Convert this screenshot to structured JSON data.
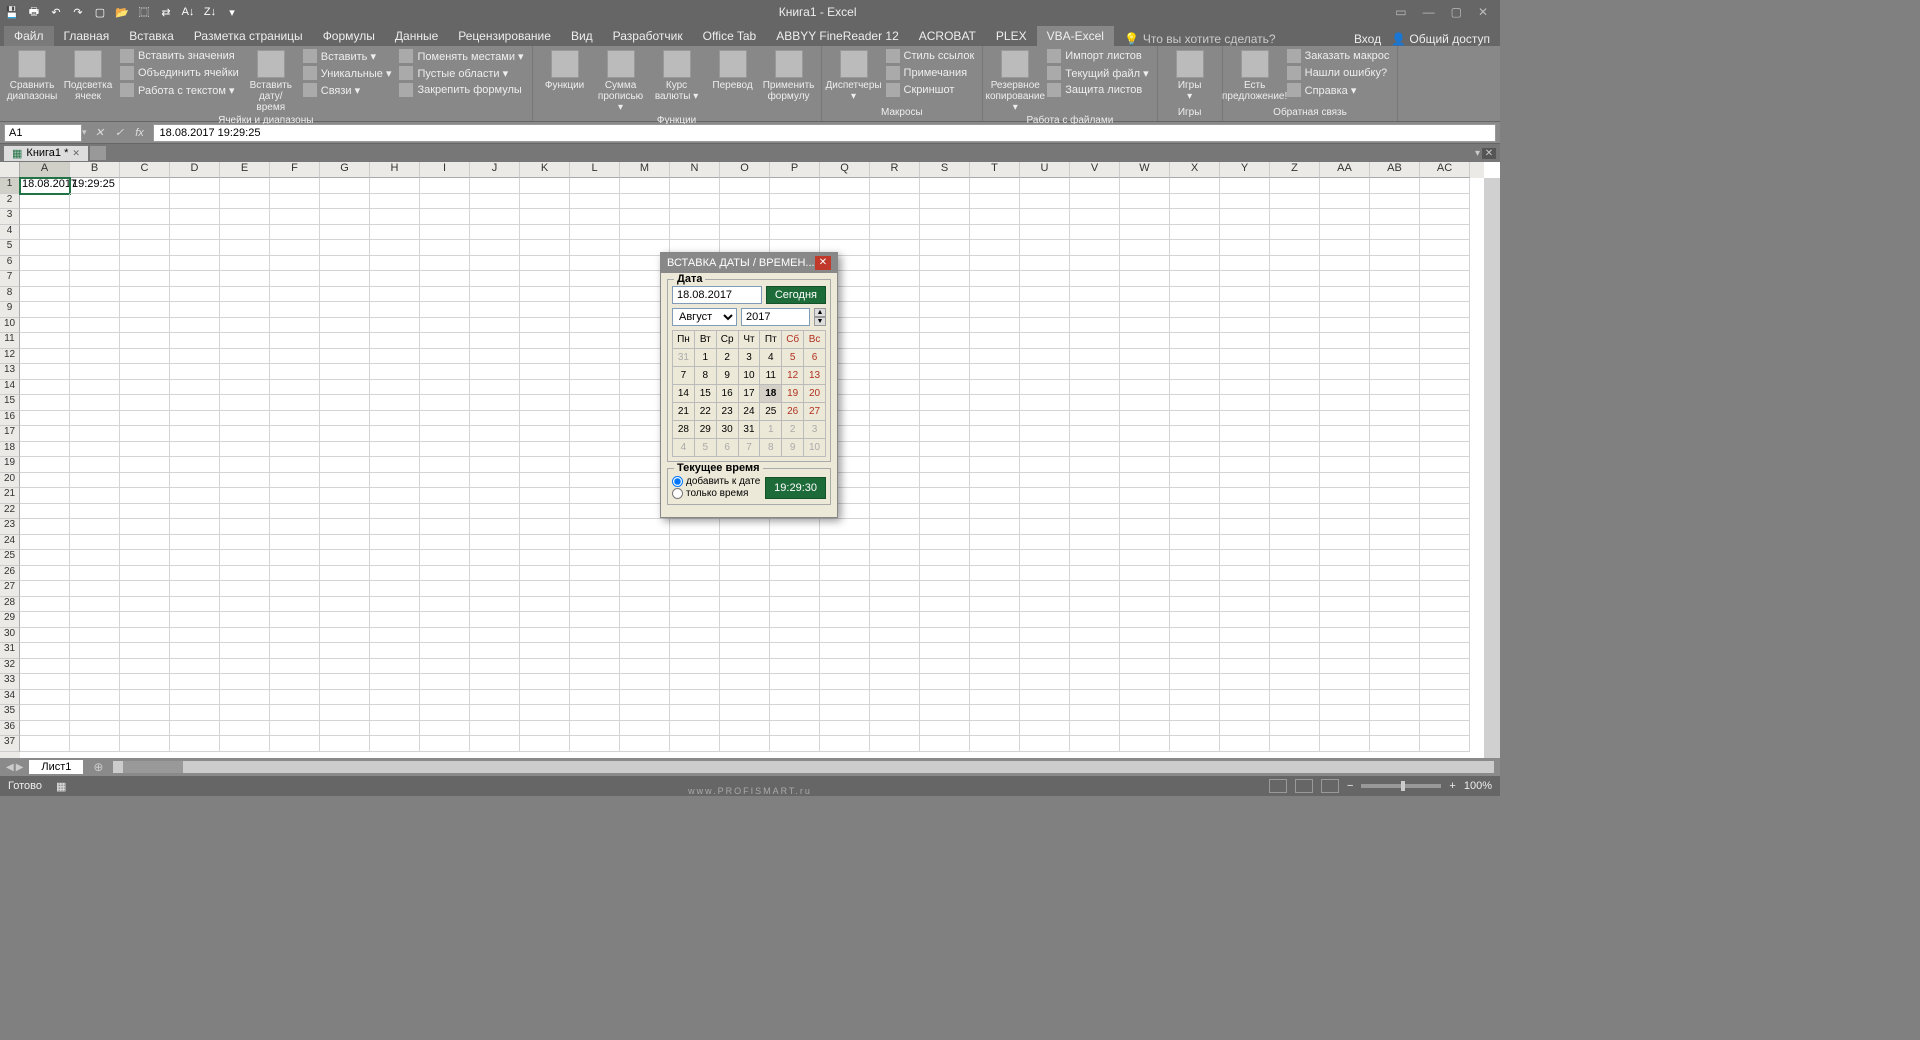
{
  "titlebar": {
    "title": "Книга1 - Excel"
  },
  "tabs": {
    "file": "Файл",
    "items": [
      "Главная",
      "Вставка",
      "Разметка страницы",
      "Формулы",
      "Данные",
      "Рецензирование",
      "Вид",
      "Разработчик",
      "Office Tab",
      "ABBYY FineReader 12",
      "ACROBAT",
      "PLEX",
      "VBA-Excel"
    ],
    "active_index": 12,
    "tellme": "Что вы хотите сделать?",
    "login": "Вход",
    "share": "Общий доступ"
  },
  "ribbon": {
    "g1": {
      "label": "Ячейки и диапазоны",
      "big": [
        "Сравнить\nдиапазоны",
        "Подсветка\nячеек"
      ],
      "small1": [
        "Вставить значения",
        "Объединить ячейки",
        "Работа с текстом ▾"
      ],
      "big2": "Вставить\nдату/время",
      "small2": [
        "Вставить ▾",
        "Уникальные ▾",
        "Связи ▾"
      ],
      "small3": [
        "Поменять местами ▾",
        "Пустые области ▾",
        "Закрепить формулы"
      ]
    },
    "g2": {
      "label": "Функции",
      "big": [
        "Функции",
        "Сумма\nпрописью ▾",
        "Курс\nвалюты ▾",
        "Перевод",
        "Применить\nформулу"
      ]
    },
    "g3": {
      "label": "Макросы",
      "big": [
        "Диспетчеры\n▾"
      ],
      "small": [
        "Стиль ссылок",
        "Примечания",
        "Скриншот"
      ]
    },
    "g4": {
      "label": "Работа с файлами",
      "big": "Резервное\nкопирование ▾",
      "small": [
        "Импорт листов",
        "Текущий файл ▾",
        "Защита листов"
      ]
    },
    "g5": {
      "label": "Игры",
      "big": "Игры\n▾"
    },
    "g6": {
      "label": "Обратная связь",
      "big": "Есть\nпредложение!",
      "small": [
        "Заказать макрос",
        "Нашли ошибку?",
        "Справка ▾"
      ]
    }
  },
  "fbar": {
    "name": "A1",
    "formula": "18.08.2017 19:29:25"
  },
  "doctab": "Книга1 *",
  "columns": [
    "A",
    "B",
    "C",
    "D",
    "E",
    "F",
    "G",
    "H",
    "I",
    "J",
    "K",
    "L",
    "M",
    "N",
    "O",
    "P",
    "Q",
    "R",
    "S",
    "T",
    "U",
    "V",
    "W",
    "X",
    "Y",
    "Z",
    "AA",
    "AB",
    "AC"
  ],
  "cells": {
    "A1": "18.08.2017",
    "B1": "19:29:25"
  },
  "sheet": "Лист1",
  "status": {
    "ready": "Готово",
    "zoom": "100%"
  },
  "dialog": {
    "title": "ВСТАВКА ДАТЫ / ВРЕМЕН...",
    "date_legend": "Дата",
    "date_value": "18.08.2017",
    "today": "Сегодня",
    "month": "Август",
    "year": "2017",
    "dow": [
      "Пн",
      "Вт",
      "Ср",
      "Чт",
      "Пт",
      "Сб",
      "Вс"
    ],
    "weeks": [
      [
        {
          "d": "31",
          "o": true
        },
        {
          "d": "1"
        },
        {
          "d": "2"
        },
        {
          "d": "3"
        },
        {
          "d": "4"
        },
        {
          "d": "5",
          "w": true
        },
        {
          "d": "6",
          "w": true
        }
      ],
      [
        {
          "d": "7"
        },
        {
          "d": "8"
        },
        {
          "d": "9"
        },
        {
          "d": "10"
        },
        {
          "d": "11"
        },
        {
          "d": "12",
          "w": true
        },
        {
          "d": "13",
          "w": true
        }
      ],
      [
        {
          "d": "14"
        },
        {
          "d": "15"
        },
        {
          "d": "16"
        },
        {
          "d": "17"
        },
        {
          "d": "18",
          "t": true
        },
        {
          "d": "19",
          "w": true
        },
        {
          "d": "20",
          "w": true
        }
      ],
      [
        {
          "d": "21"
        },
        {
          "d": "22"
        },
        {
          "d": "23"
        },
        {
          "d": "24"
        },
        {
          "d": "25"
        },
        {
          "d": "26",
          "w": true
        },
        {
          "d": "27",
          "w": true
        }
      ],
      [
        {
          "d": "28"
        },
        {
          "d": "29"
        },
        {
          "d": "30"
        },
        {
          "d": "31"
        },
        {
          "d": "1",
          "o": true
        },
        {
          "d": "2",
          "o": true,
          "w": true
        },
        {
          "d": "3",
          "o": true,
          "w": true
        }
      ],
      [
        {
          "d": "4",
          "o": true
        },
        {
          "d": "5",
          "o": true
        },
        {
          "d": "6",
          "o": true
        },
        {
          "d": "7",
          "o": true
        },
        {
          "d": "8",
          "o": true
        },
        {
          "d": "9",
          "o": true,
          "w": true
        },
        {
          "d": "10",
          "o": true,
          "w": true
        }
      ]
    ],
    "time_legend": "Текущее время",
    "opt1": "добавить к дате",
    "opt2": "только время",
    "time_value": "19:29:30"
  },
  "watermark": "www.PROFISMART.ru"
}
